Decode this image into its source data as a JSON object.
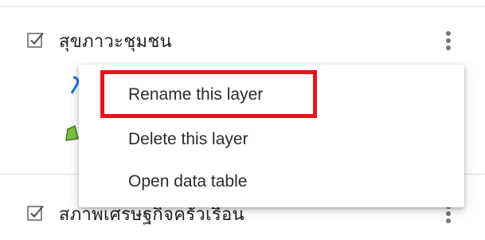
{
  "layers": [
    {
      "name": "สุขภาวะชุมชน",
      "checked": true,
      "menu_icon": "more-vert-icon"
    },
    {
      "name": "สภาพเศรษฐกิจครัวเรือน",
      "checked": true,
      "menu_icon": "more-vert-icon"
    }
  ],
  "context_menu": {
    "items": [
      {
        "label": "Rename this layer",
        "highlighted": true
      },
      {
        "label": "Delete this layer"
      },
      {
        "label": "Open data table"
      }
    ]
  },
  "colors": {
    "highlight_border": "#e8141b",
    "style_icon_blue": "#1a73e8",
    "style_icon_green": "#7cc243",
    "text": "#212121",
    "icon_grey": "#757575"
  }
}
